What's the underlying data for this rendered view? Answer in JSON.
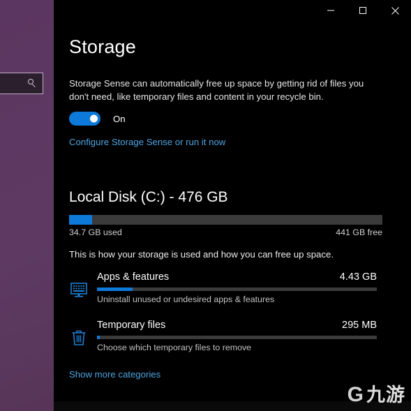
{
  "desktop": {
    "background_color": "#5e3a63",
    "search": {
      "value": "",
      "placeholder": "",
      "icon": "search-icon"
    }
  },
  "window": {
    "background_color": "#000000",
    "accent_color": "#0d7ad9",
    "link_color": "#4ea3e0",
    "titlebar": {
      "minimize_label": "Minimize",
      "maximize_label": "Maximize",
      "close_label": "Close"
    },
    "page_title": "Storage",
    "storage_sense": {
      "description": "Storage Sense can automatically free up space by getting rid of files you don't need, like temporary files and content in your recycle bin.",
      "toggle_state": "On",
      "toggle_on": true,
      "configure_link": "Configure Storage Sense or run it now"
    },
    "local_disk": {
      "title": "Local Disk (C:) - 476 GB",
      "used_label": "34.7 GB used",
      "free_label": "441 GB free",
      "used_percent": 7.3,
      "capacity_gb": 476,
      "used_gb": 34.7,
      "free_gb": 441
    },
    "howto_text": "This is how your storage is used and how you can free up space.",
    "categories": [
      {
        "icon": "monitor-apps-icon",
        "name": "Apps & features",
        "size": "4.43 GB",
        "percent": 12.7,
        "description": "Uninstall unused or undesired apps & features"
      },
      {
        "icon": "trash-bin-icon",
        "name": "Temporary files",
        "size": "295 MB",
        "percent": 1.1,
        "description": "Choose which temporary files to remove"
      }
    ],
    "show_more_link": "Show more categories"
  },
  "watermark": {
    "mark": "G",
    "text": "九游"
  }
}
